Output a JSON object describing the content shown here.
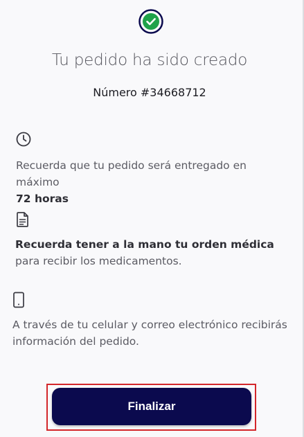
{
  "header": {
    "icon": "success-check-icon",
    "title": "Tu pedido ha sido creado",
    "order_number": "Número #34668712"
  },
  "info": [
    {
      "icon": "clock-icon",
      "text": "Recuerda que tu pedido será entregado en máximo ",
      "bold": "72 horas"
    },
    {
      "icon": "document-icon",
      "bold": "Recuerda tener a la mano tu orden médica",
      "text": " para recibir los medicamentos."
    },
    {
      "icon": "phone-icon",
      "text": "A través de tu celular  y correo electrónico recibirás información del pedido."
    }
  ],
  "actions": {
    "finalize_label": "Finalizar"
  },
  "colors": {
    "accent": "#0b0a4e",
    "success": "#1fa24a",
    "highlight": "#d3262a"
  }
}
